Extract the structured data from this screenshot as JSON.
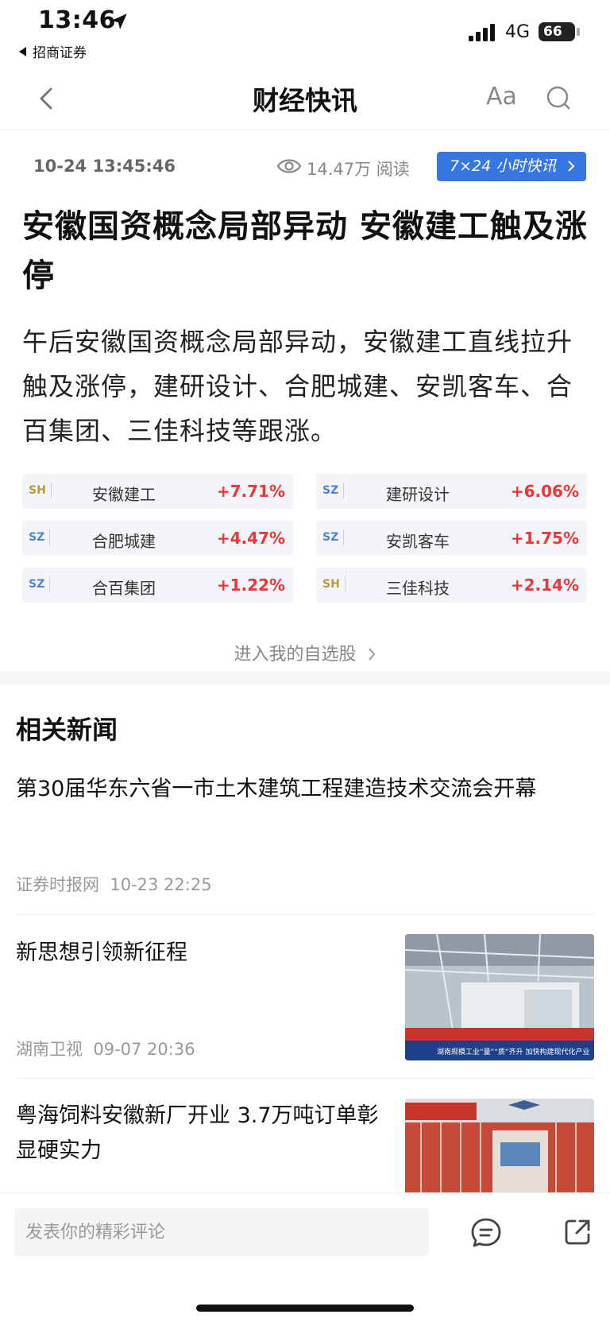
{
  "status_bar": {
    "time": "13:46",
    "back_app": "招商证券",
    "network": "4G",
    "battery": "66"
  },
  "nav": {
    "title": "财经快讯",
    "font_button": "Aa"
  },
  "article": {
    "datetime": "10-24 13:45:46",
    "reads": "14.47万 阅读",
    "live_button": "7×24 小时快讯",
    "headline": "安徽国资概念局部异动 安徽建工触及涨停",
    "summary": "午后安徽国资概念局部异动，安徽建工直线拉升触及涨停，建研设计、合肥城建、安凯客车、合百集团、三佳科技等跟涨。"
  },
  "stocks": [
    {
      "market": "SH",
      "name": "安徽建工",
      "change": "+7.71%"
    },
    {
      "market": "SZ",
      "name": "建研设计",
      "change": "+6.06%"
    },
    {
      "market": "SZ",
      "name": "合肥城建",
      "change": "+4.47%"
    },
    {
      "market": "SZ",
      "name": "安凯客车",
      "change": "+1.75%"
    },
    {
      "market": "SZ",
      "name": "合百集团",
      "change": "+1.22%"
    },
    {
      "market": "SH",
      "name": "三佳科技",
      "change": "+2.14%"
    }
  ],
  "watchlist_link": "进入我的自选股",
  "related": {
    "title": "相关新闻",
    "items": [
      {
        "title": "第30届华东六省一市土木建筑工程建造技术交流会开幕",
        "source": "证券时报网",
        "time": "10-23 22:25"
      },
      {
        "title": "新思想引领新征程",
        "source": "湖南卫视",
        "time": "09-07 20:36",
        "thumb_caption": "湖南规模工业“量”“质”齐升 加快构建现代化产业"
      },
      {
        "title": "粤海饲料安徽新厂开业 3.7万吨订单彰显硬实力"
      }
    ]
  },
  "bottom": {
    "comment_placeholder": "发表你的精彩评论"
  },
  "colors": {
    "accent": "#3576e0",
    "up": "#ef3535",
    "sh": "#b79a3a",
    "sz": "#4a82e0"
  },
  "icons": [
    "location-arrow-icon",
    "signal-icon",
    "back-chevron-icon",
    "search-icon",
    "eye-icon",
    "chevron-right-icon",
    "comment-icon",
    "share-icon"
  ]
}
